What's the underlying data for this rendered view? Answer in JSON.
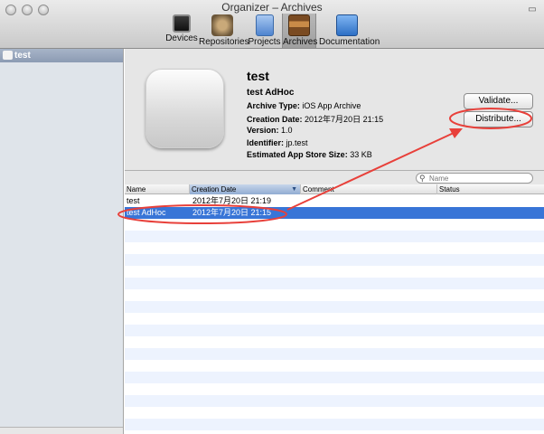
{
  "window": {
    "title": "Organizer – Archives"
  },
  "toolbar": {
    "items": [
      {
        "label": "Devices",
        "icon": "devices-icon"
      },
      {
        "label": "Repositories",
        "icon": "repositories-icon"
      },
      {
        "label": "Projects",
        "icon": "projects-icon"
      },
      {
        "label": "Archives",
        "icon": "archives-icon",
        "active": true
      },
      {
        "label": "Documentation",
        "icon": "documentation-icon"
      }
    ]
  },
  "sidebar": {
    "items": [
      {
        "label": "test",
        "selected": true
      }
    ]
  },
  "detail": {
    "app_name": "test",
    "archive_name": "test AdHoc",
    "archive_type_label": "Archive Type:",
    "archive_type": "iOS App Archive",
    "creation_date_label": "Creation Date:",
    "creation_date": "2012年7月20日 21:15",
    "version_label": "Version:",
    "version": "1.0",
    "identifier_label": "Identifier:",
    "identifier": "jp.test",
    "size_label": "Estimated App Store Size:",
    "size": "33 KB",
    "validate_label": "Validate...",
    "distribute_label": "Distribute..."
  },
  "search": {
    "placeholder": "Name"
  },
  "table": {
    "columns": [
      "Name",
      "Creation Date",
      "Comment",
      "Status"
    ],
    "sorted_column": "Creation Date",
    "rows": [
      {
        "name": "test",
        "date": "2012年7月20日 21:19",
        "comment": "",
        "status": "",
        "selected": false
      },
      {
        "name": "test AdHoc",
        "date": "2012年7月20日 21:15",
        "comment": "",
        "status": "",
        "selected": true
      }
    ]
  },
  "colors": {
    "selection": "#3875d7",
    "annotation": "#e8403a",
    "sidebar": "#dfe4ea"
  }
}
